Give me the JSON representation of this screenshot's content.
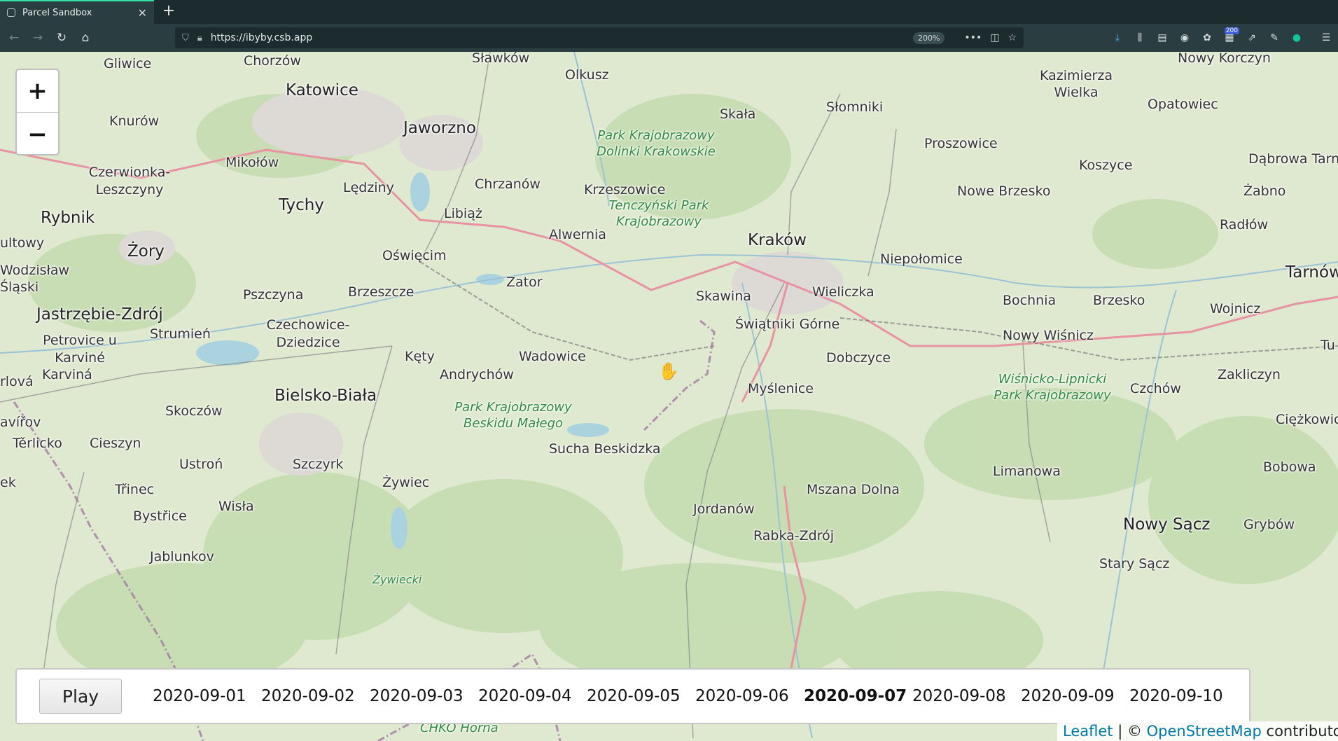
{
  "browser": {
    "tab_title": "Parcel Sandbox",
    "url": "https://ibyby.csb.app",
    "zoom": "200%",
    "badge_count": "200"
  },
  "map": {
    "zoom_in": "+",
    "zoom_out": "−",
    "places": [
      {
        "name": "Gliwice"
      },
      {
        "name": "Chorzów"
      },
      {
        "name": "Sławków"
      },
      {
        "name": "Olkusz"
      },
      {
        "name": "Kazimierza Wielka"
      },
      {
        "name": "Nowy Korczyn"
      },
      {
        "name": "Katowice"
      },
      {
        "name": "Knurów"
      },
      {
        "name": "Jaworzno"
      },
      {
        "name": "Skała"
      },
      {
        "name": "Słomniki"
      },
      {
        "name": "Opatowiec"
      },
      {
        "name": "Czerwionka-Leszczyny"
      },
      {
        "name": "Mikołów"
      },
      {
        "name": "Proszowice"
      },
      {
        "name": "Koszyce"
      },
      {
        "name": "Dąbrowa Tarn"
      },
      {
        "name": "Lędziny"
      },
      {
        "name": "Chrzanów"
      },
      {
        "name": "Krzeszowice"
      },
      {
        "name": "Nowe Brzesko"
      },
      {
        "name": "Żabno"
      },
      {
        "name": "Tychy"
      },
      {
        "name": "Libiąż"
      },
      {
        "name": "Rybnik"
      },
      {
        "name": "Radłów"
      },
      {
        "name": "Alwernia"
      },
      {
        "name": "Kraków"
      },
      {
        "name": "ultowy"
      },
      {
        "name": "Żory"
      },
      {
        "name": "Oświęcim"
      },
      {
        "name": "Niepołomice"
      },
      {
        "name": "Tarnów"
      },
      {
        "name": "Wodzisław Śląski"
      },
      {
        "name": "Zator"
      },
      {
        "name": "Pszczyna"
      },
      {
        "name": "Brzeszcze"
      },
      {
        "name": "Skawina"
      },
      {
        "name": "Wieliczka"
      },
      {
        "name": "Bochnia"
      },
      {
        "name": "Brzesko"
      },
      {
        "name": "Wojnicz"
      },
      {
        "name": "Jastrzębie-Zdrój"
      },
      {
        "name": "Świątniki Górne"
      },
      {
        "name": "Strumień"
      },
      {
        "name": "Czechowice-Dziedzice"
      },
      {
        "name": "Petrovice u Karviné"
      },
      {
        "name": "Nowy Wiśnicz"
      },
      {
        "name": "Tu"
      },
      {
        "name": "Dobczyce"
      },
      {
        "name": "Kęty"
      },
      {
        "name": "Wadowice"
      },
      {
        "name": "rlová"
      },
      {
        "name": "Karviná"
      },
      {
        "name": "Andrychów"
      },
      {
        "name": "Zakliczyn"
      },
      {
        "name": "Myślenice"
      },
      {
        "name": "Czchów"
      },
      {
        "name": "Bielsko-Biała"
      },
      {
        "name": "Skoczów"
      },
      {
        "name": "Ciężkowice"
      },
      {
        "name": "avířov"
      },
      {
        "name": "Těrlicko"
      },
      {
        "name": "Cieszyn"
      },
      {
        "name": "Sucha Beskidzka"
      },
      {
        "name": "Ustroń"
      },
      {
        "name": "Szczyrk"
      },
      {
        "name": "Limanowa"
      },
      {
        "name": "Bobowa"
      },
      {
        "name": "ek"
      },
      {
        "name": "Żywiec"
      },
      {
        "name": "Mszana Dolna"
      },
      {
        "name": "Třinec"
      },
      {
        "name": "Wisła"
      },
      {
        "name": "Jordanów"
      },
      {
        "name": "Nowy Sącz"
      },
      {
        "name": "Grybów"
      },
      {
        "name": "Bystřice"
      },
      {
        "name": "Rabka-Zdrój"
      },
      {
        "name": "Jablunkov"
      },
      {
        "name": "Stary Sącz"
      },
      {
        "name": "Żywiecki"
      },
      {
        "name": "CHKO Horná"
      }
    ],
    "parks": [
      {
        "name": "Park Krajobrazowy Dolinki Krakowskie"
      },
      {
        "name": "Tenczyński Park Krajobrazowy"
      },
      {
        "name": "Park Krajobrazowy Beskidu Małego"
      },
      {
        "name": "Wiśnicko-Lipnicki Park Krajobrazowy"
      }
    ]
  },
  "timeline": {
    "play_label": "Play",
    "dates": [
      "2020-09-01",
      "2020-09-02",
      "2020-09-03",
      "2020-09-04",
      "2020-09-05",
      "2020-09-06",
      "2020-09-07",
      "2020-09-08",
      "2020-09-09",
      "2020-09-10"
    ],
    "active_index": 6
  },
  "attribution": {
    "leaflet": "Leaflet",
    "separator": " | © ",
    "osm": "OpenStreetMap",
    "suffix": " contributors"
  }
}
